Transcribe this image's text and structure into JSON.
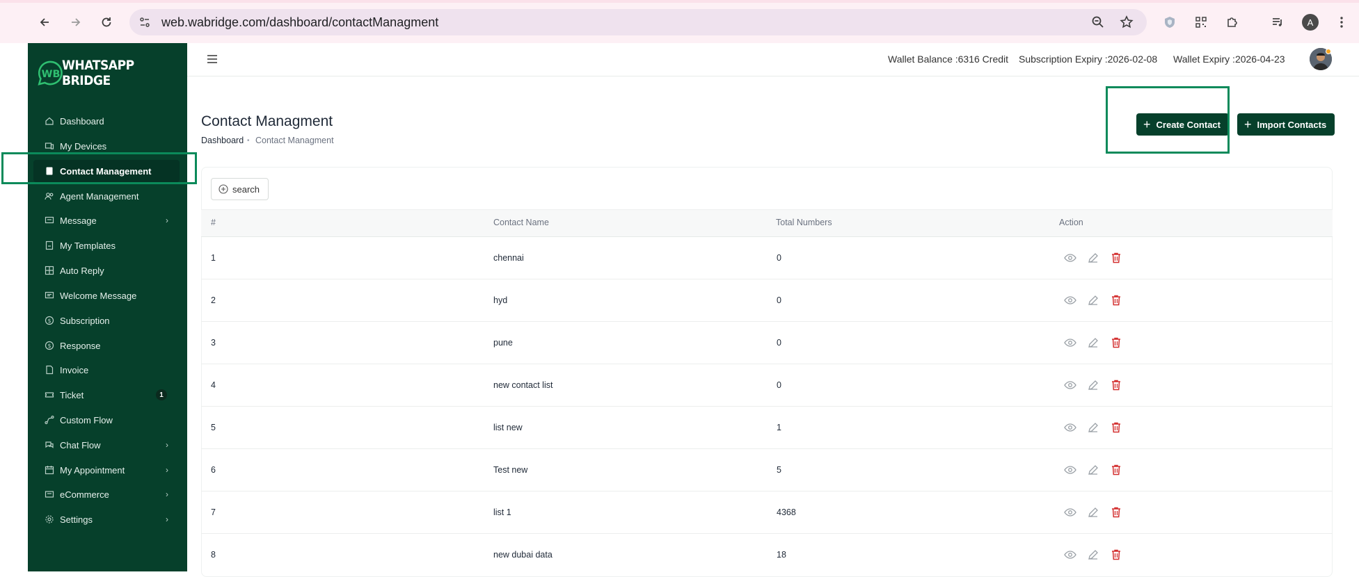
{
  "browser": {
    "url": "web.wabridge.com/dashboard/contactManagment",
    "profile_initial": "A"
  },
  "brand": {
    "name": "WHATSAPP BRIDGE",
    "mark": "WB",
    "sidebar_color": "#06402b",
    "highlight_color": "#0b8a5a",
    "danger_color": "#d32f2f"
  },
  "sidebar": {
    "items": [
      {
        "label": "Dashboard",
        "icon": "home-icon"
      },
      {
        "label": "My Devices",
        "icon": "devices-icon"
      },
      {
        "label": "Contact Management",
        "icon": "book-icon",
        "active": true
      },
      {
        "label": "Agent Management",
        "icon": "users-icon"
      },
      {
        "label": "Message",
        "icon": "message-icon",
        "has_submenu": true
      },
      {
        "label": "My Templates",
        "icon": "template-icon"
      },
      {
        "label": "Auto Reply",
        "icon": "grid-icon"
      },
      {
        "label": "Welcome Message",
        "icon": "welcome-icon"
      },
      {
        "label": "Subscription",
        "icon": "dollar-icon"
      },
      {
        "label": "Response",
        "icon": "dollar-icon"
      },
      {
        "label": "Invoice",
        "icon": "invoice-icon"
      },
      {
        "label": "Ticket",
        "icon": "ticket-icon",
        "badge": "1"
      },
      {
        "label": "Custom Flow",
        "icon": "flow-icon"
      },
      {
        "label": "Chat Flow",
        "icon": "chat-icon",
        "has_submenu": true
      },
      {
        "label": "My Appointment",
        "icon": "calendar-icon",
        "has_submenu": true
      },
      {
        "label": "eCommerce",
        "icon": "cart-icon",
        "has_submenu": true
      },
      {
        "label": "Settings",
        "icon": "gear-icon",
        "has_submenu": true
      }
    ]
  },
  "header": {
    "wallet_balance": "Wallet Balance :6316 Credit",
    "subscription_expiry": "Subscription Expiry :2026-02-08",
    "wallet_expiry": "Wallet Expiry :2026-04-23"
  },
  "page": {
    "title": "Contact Managment",
    "breadcrumb_home": "Dashboard",
    "breadcrumb_separator": "•",
    "breadcrumb_current": "Contact Managment",
    "create_button": "Create Contact",
    "import_button": "Import Contacts",
    "search_button": "search"
  },
  "table": {
    "columns": [
      "#",
      "Contact Name",
      "Total Numbers",
      "Action"
    ],
    "rows": [
      {
        "index": "1",
        "name": "chennai",
        "total": "0"
      },
      {
        "index": "2",
        "name": "hyd",
        "total": "0"
      },
      {
        "index": "3",
        "name": "pune",
        "total": "0"
      },
      {
        "index": "4",
        "name": "new contact list",
        "total": "0"
      },
      {
        "index": "5",
        "name": "list new",
        "total": "1"
      },
      {
        "index": "6",
        "name": "Test new",
        "total": "5"
      },
      {
        "index": "7",
        "name": "list 1",
        "total": "4368"
      },
      {
        "index": "8",
        "name": "new dubai data",
        "total": "18"
      }
    ]
  }
}
